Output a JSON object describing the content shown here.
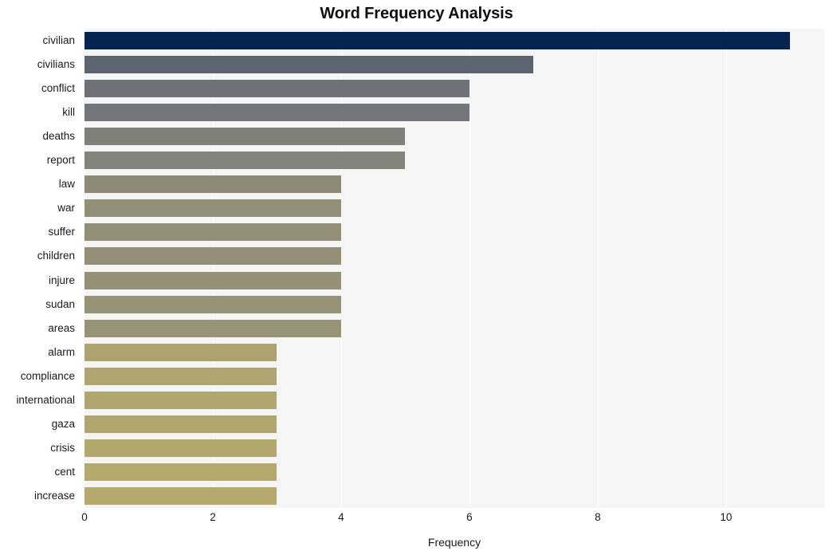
{
  "chart_data": {
    "type": "bar",
    "orientation": "horizontal",
    "title": "Word Frequency Analysis",
    "xlabel": "Frequency",
    "ylabel": "",
    "categories": [
      "civilian",
      "civilians",
      "conflict",
      "kill",
      "deaths",
      "report",
      "law",
      "war",
      "suffer",
      "children",
      "injure",
      "sudan",
      "areas",
      "alarm",
      "compliance",
      "international",
      "gaza",
      "crisis",
      "cent",
      "increase"
    ],
    "values": [
      11,
      7,
      6,
      6,
      5,
      5,
      4,
      4,
      4,
      4,
      4,
      4,
      4,
      3,
      3,
      3,
      3,
      3,
      3,
      3
    ],
    "bar_colors": [
      "#062450",
      "#5e6370",
      "#6e7175",
      "#72757a",
      "#7f8079",
      "#83847c",
      "#8d8b78",
      "#918f77",
      "#938f76",
      "#949077",
      "#959177",
      "#969277",
      "#979377",
      "#ad a36f",
      "#afa570",
      "#b0a670",
      "#b1a76e",
      "#b2a86e",
      "#b3a86e",
      "#b5a96e"
    ],
    "xlim": [
      0,
      11.53
    ],
    "xticks": [
      0,
      2,
      4,
      6,
      8,
      10
    ],
    "xtick_labels": [
      "0",
      "2",
      "4",
      "6",
      "8",
      "10"
    ],
    "grid": "vertical",
    "plot_background": "#f5f5f6",
    "figure_background": "#ffffff",
    "legend": "none"
  }
}
